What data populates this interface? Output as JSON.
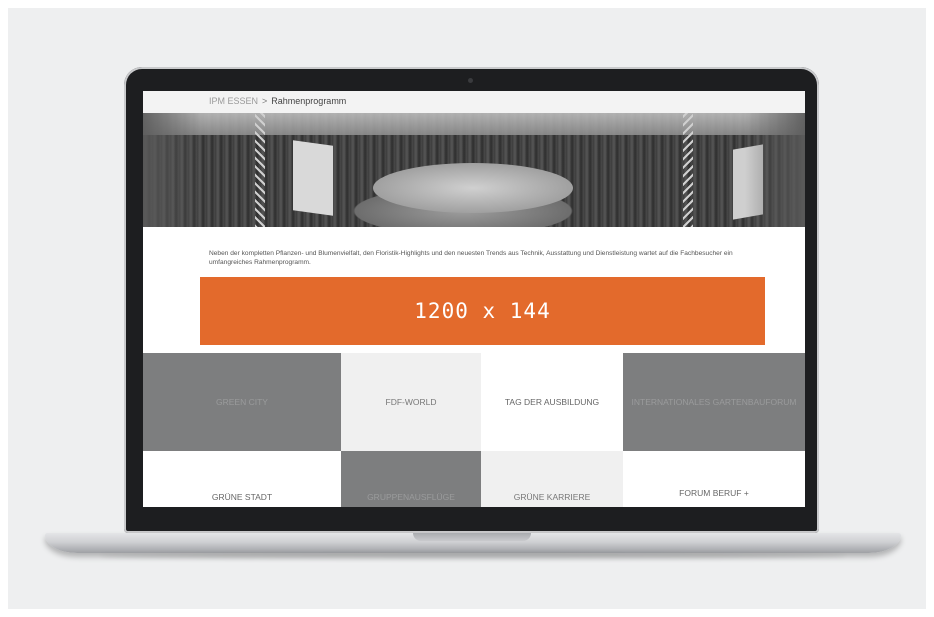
{
  "breadcrumb": {
    "parent": "IPM ESSEN",
    "separator": ">",
    "current": "Rahmenprogramm"
  },
  "intro_text": "Neben der kompletten Pflanzen- und Blumenvielfalt, den Floristik-Highlights und den neuesten Trends aus Technik, Ausstattung und Dienstleistung wartet auf die Fachbesucher ein umfangreiches Rahmenprogramm.",
  "banner": {
    "label": "1200 x 144",
    "color": "#e36a2c"
  },
  "tiles_row1": [
    {
      "label": "GREEN CITY",
      "style": "dark"
    },
    {
      "label": "FDF-WORLD",
      "style": "light"
    },
    {
      "label": "TAG DER AUSBILDUNG",
      "style": "white"
    },
    {
      "label": "INTERNATIONALES GARTENBAUFORUM",
      "style": "dark"
    }
  ],
  "tiles_row2": [
    {
      "label": "GRÜNE STADT",
      "style": "white"
    },
    {
      "label": "GRUPPENAUSFLÜGE",
      "style": "dark"
    },
    {
      "label": "GRÜNE KARRIERE",
      "style": "light"
    },
    {
      "label": "FORUM BERUF +",
      "style": "white"
    }
  ]
}
